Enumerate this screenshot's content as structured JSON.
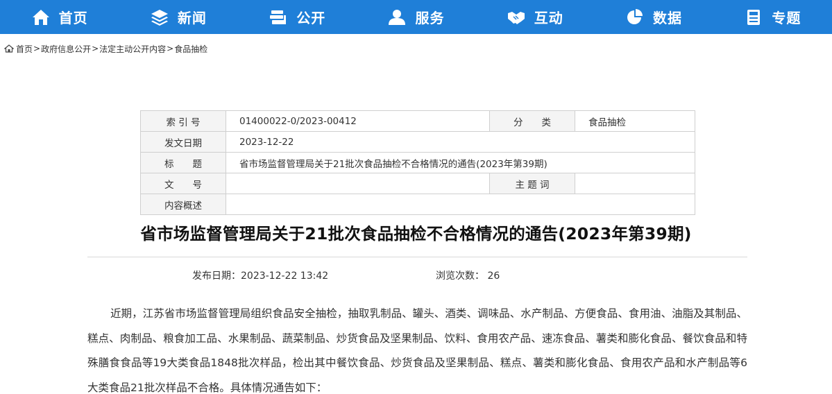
{
  "nav": {
    "items": [
      {
        "label": "首页",
        "icon": "home-icon"
      },
      {
        "label": "新闻",
        "icon": "layers-icon"
      },
      {
        "label": "公开",
        "icon": "books-icon"
      },
      {
        "label": "服务",
        "icon": "user-icon"
      },
      {
        "label": "互动",
        "icon": "handshake-icon"
      },
      {
        "label": "数据",
        "icon": "pie-chart-icon"
      },
      {
        "label": "专题",
        "icon": "calculator-icon"
      }
    ],
    "bg_color": "#1f7fd8"
  },
  "breadcrumb": {
    "items": [
      "首页",
      "政府信息公开",
      "法定主动公开内容",
      "食品抽检"
    ],
    "separator": ">"
  },
  "info": {
    "index_label": "索 引 号",
    "index_value": "01400022-0/2023-00412",
    "category_label": "分　　类",
    "category_value": "食品抽检",
    "date_label": "发文日期",
    "date_value": "2023-12-22",
    "title_label": "标　　题",
    "title_value": "省市场监督管理局关于21批次食品抽检不合格情况的通告(2023年第39期)",
    "docno_label": "文　　号",
    "docno_value": "",
    "keywords_label": "主 题 词",
    "keywords_value": "",
    "summary_label": "内容概述",
    "summary_value": ""
  },
  "article": {
    "title": "省市场监督管理局关于21批次食品抽检不合格情况的通告(2023年第39期)",
    "publish_date": "发布日期：2023-12-22 13:42",
    "views": "浏览次数： 26",
    "body": "近期，江苏省市场监督管理局组织食品安全抽检，抽取乳制品、罐头、酒类、调味品、水产制品、方便食品、食用油、油脂及其制品、糕点、肉制品、粮食加工品、水果制品、蔬菜制品、炒货食品及坚果制品、饮料、食用农产品、速冻食品、薯类和膨化食品、餐饮食品和特殊膳食食品等19大类食品1848批次样品，检出其中餐饮食品、炒货食品及坚果制品、糕点、薯类和膨化食品、食用农产品和水产制品等6大类食品21批次样品不合格。具体情况通告如下："
  }
}
